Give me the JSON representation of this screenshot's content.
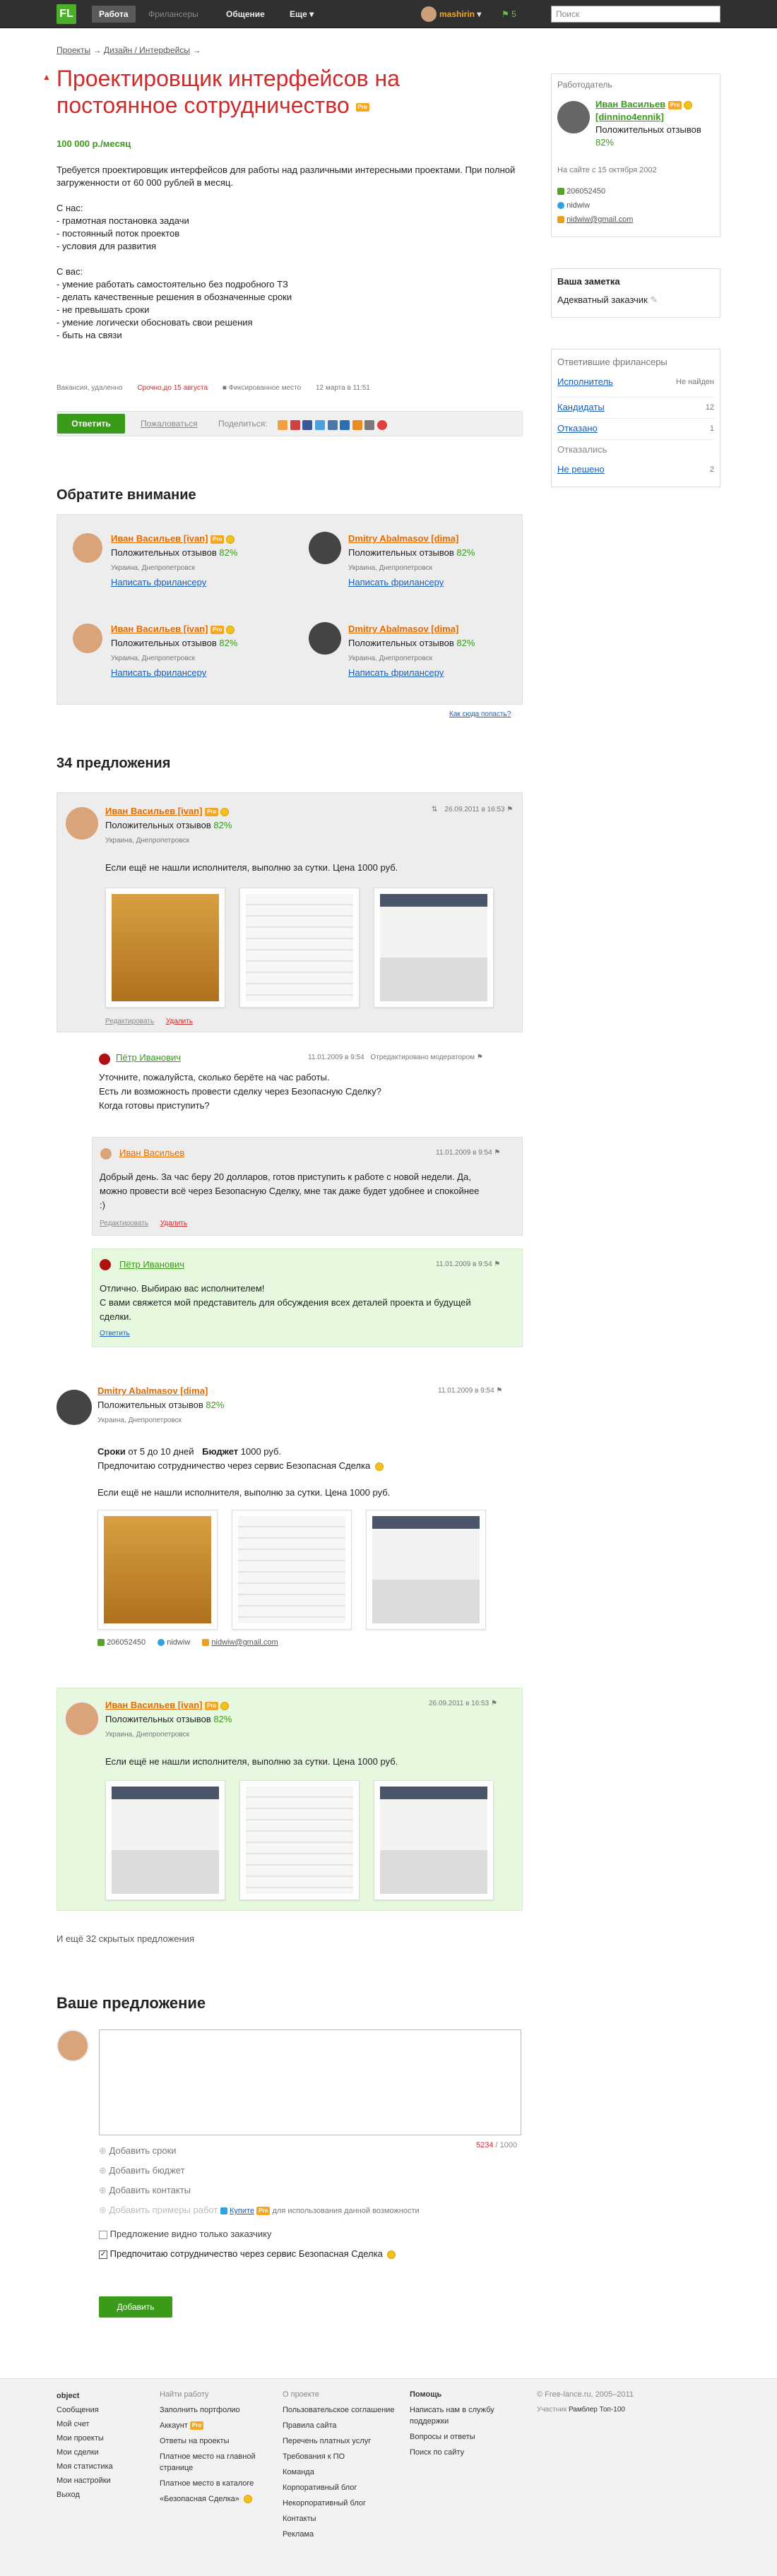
{
  "topbar": {
    "logo": "FL",
    "nav": [
      "Работа",
      "Фрилансеры",
      "Общение",
      "Еще"
    ],
    "user": "mashirin",
    "score": "5",
    "search_placeholder": "Поиск"
  },
  "breadcrumb": {
    "items": [
      "Проекты",
      "Дизайн / Интерфейсы"
    ]
  },
  "project": {
    "title": "Проектировщик интерфейсов на постоянное сотрудничество",
    "pro": "Pro",
    "price": "100 000 р./месяц",
    "description_1": "Требуется проектировщик интерфейсов для работы над различными интересными проектами. При полной загруженности от 60 000 рублей в месяц.",
    "from_us_title": "С нас:",
    "from_us": [
      "- грамотная постановка задачи",
      "- постоянный поток проектов",
      "- условия для развития"
    ],
    "from_you_title": "С вас:",
    "from_you": [
      "- умение работать самостоятельно без подробного ТЗ",
      "- делать качественные решения в обозначенные сроки",
      "- не превышать сроки",
      "- умение логически обосновать свои решения",
      "- быть на связи"
    ],
    "meta": [
      "Вакансия, удаленно",
      "Срочно,до 15 августа",
      "Фиксированное место",
      "12 марта в 11:51"
    ],
    "reply": "Ответить",
    "complain": "Пожаловаться",
    "share": "Поделиться:"
  },
  "attention": {
    "title": "Обратите внимание",
    "cards": [
      {
        "name": "Иван Васильев [ivan]",
        "reviews": "Положительных отзывов",
        "pct": "82%",
        "loc": "Украина, Днепропетровск",
        "link": "Написать фрилансеру"
      },
      {
        "name": "Dmitry Abalmasov [dima]",
        "reviews": "Положительных отзывов",
        "pct": "82%",
        "loc": "Украина, Днепропетровск",
        "link": "Написать фрилансеру"
      },
      {
        "name": "Иван Васильев [ivan]",
        "reviews": "Положительных отзывов",
        "pct": "82%",
        "loc": "Украина, Днепропетровск",
        "link": "Написать фрилансеру"
      },
      {
        "name": "Dmitry Abalmasov [dima]",
        "reviews": "Положительных отзывов",
        "pct": "82%",
        "loc": "Украина, Днепропетровск",
        "link": "Написать фрилансеру"
      }
    ],
    "how": "Как сюда попасть?"
  },
  "offers": {
    "title": "34 предложения",
    "o1": {
      "name": "Иван Васильев [ivan]",
      "reviews": "Положительных отзывов",
      "pct": "82%",
      "loc": "Украина, Днепропетровск",
      "date": "26.09.2011 в 16:53",
      "text": "Если ещё не нашли исполнителя, выполню за сутки. Цена 1000 руб.",
      "edit": "Редактировать",
      "del": "Удалить"
    },
    "c1": {
      "name": "Пётр Иванович",
      "date": "11.01.2009 в 9:54",
      "moderated": "Отредактировано модератором",
      "lines": [
        "Уточните, пожалуйста, сколько берёте на час работы.",
        "Есть ли возможность провести сделку через Безопасную Сделку?",
        "Когда готовы приступить?"
      ]
    },
    "c2": {
      "name": "Иван Васильев",
      "date": "11.01.2009 в 9:54",
      "lines": [
        "Добрый день. За час беру 20 долларов, готов приступить к работе с новой недели. Да,",
        "можно провести всё через Безопасную Сделку, мне так даже будет удобнее и спокойнее",
        ":)"
      ],
      "edit": "Редактировать",
      "del": "Удалить"
    },
    "c3": {
      "name": "Пётр Иванович",
      "date": "11.01.2009 в 9:54",
      "lines": [
        "Отлично. Выбираю вас исполнителем!",
        "С вами свяжется мой представитель для обсуждения всех деталей проекта и будущей",
        "сделки."
      ],
      "reply": "Ответить"
    },
    "o2": {
      "name": "Dmitry Abalmasov [dima]",
      "reviews": "Положительных отзывов",
      "pct": "82%",
      "loc": "Украина, Днепропетровск",
      "date": "11.01.2009 в 9:54",
      "terms_label": "Сроки",
      "terms": "от 5 до 10 дней",
      "budget_label": "Бюджет",
      "budget": "1000 руб.",
      "safe": "Предпочитаю сотрудничество через сервис Безопасная Сделка",
      "text": "Если ещё не нашли исполнителя, выполню за сутки. Цена 1000 руб.",
      "phone": "206052450",
      "skype": "nidwiw",
      "mail": "nidwiw@gmail.com"
    },
    "o3": {
      "name": "Иван Васильев [ivan]",
      "reviews": "Положительных отзывов",
      "pct": "82%",
      "loc": "Украина, Днепропетровск",
      "date": "26.09.2011 в 16:53",
      "text": "Если ещё не нашли исполнителя, выполню за сутки. Цена 1000 руб."
    },
    "hidden": "И ещё 32 скрытых предложения"
  },
  "your_offer": {
    "title": "Ваше предложение",
    "counter": "5234",
    "counter_max": "/ 1000",
    "add_terms": "Добавить сроки",
    "add_budget": "Добавить бюджет",
    "add_contacts": "Добавить контакты",
    "add_examples": "Добавить примеры работ",
    "buy": "Купите",
    "buy_rest": "для использования данной возможности",
    "only_customer": "Предложение видно только заказчику",
    "prefer_safe": "Предпочитаю сотрудничество через сервис Безопасная Сделка",
    "submit": "Добавить"
  },
  "sidebar": {
    "employer_title": "Работодатель",
    "name": "Иван Васильев",
    "login": "[dinnino4ennik]",
    "reviews": "Положительных отзывов",
    "pct": "82%",
    "since": "На сайте с 15 октября 2002",
    "phone": "206052450",
    "skype": "nidwiw",
    "mail": "nidwiw@gmail.com",
    "note_title": "Ваша заметка",
    "note": "Адекватный заказчик",
    "resp_title": "Ответившие фрилансеры",
    "rows": [
      {
        "label": "Исполнитель",
        "value": "Не найден"
      },
      {
        "label": "Кандидаты",
        "value": "12"
      },
      {
        "label": "Отказано",
        "value": "1"
      }
    ],
    "refused_title": "Отказались",
    "not_decided": "Не решено",
    "not_decided_val": "2"
  },
  "footer": {
    "col1": [
      "Сообщения",
      "Мой счет",
      "Мои проекты",
      "Мои сделки",
      "Моя статистика",
      "Мои настройки",
      "Выход"
    ],
    "col1_title": "object",
    "col2_title": "Найти работу",
    "col2": [
      "Заполнить портфолио",
      "Аккаунт",
      "Ответы на проекты",
      "Платное место на главной странице",
      "Платное место в каталоге",
      "«Безопасная Сделка»"
    ],
    "col3_title": "О проекте",
    "col3": [
      "Пользовательское соглашение",
      "Правила сайта",
      "Перечень платных услуг",
      "Требования к ПО",
      "Команда",
      "Корпоративный блог",
      "Некорпоративный блог",
      "Контакты",
      "Реклама"
    ],
    "col4_title": "Помощь",
    "col4": [
      "Написать нам в службу поддержки",
      "Вопросы и ответы",
      "Поиск по сайту"
    ],
    "copyright": "© Free-lance.ru, 2005–2011",
    "member": "Участник",
    "rambler": "Рамблер Топ-100"
  },
  "colors": {
    "accent": "#3a9a1a",
    "title": "#d02a2a",
    "name": "#e36b00",
    "link": "#1a5fb4"
  }
}
